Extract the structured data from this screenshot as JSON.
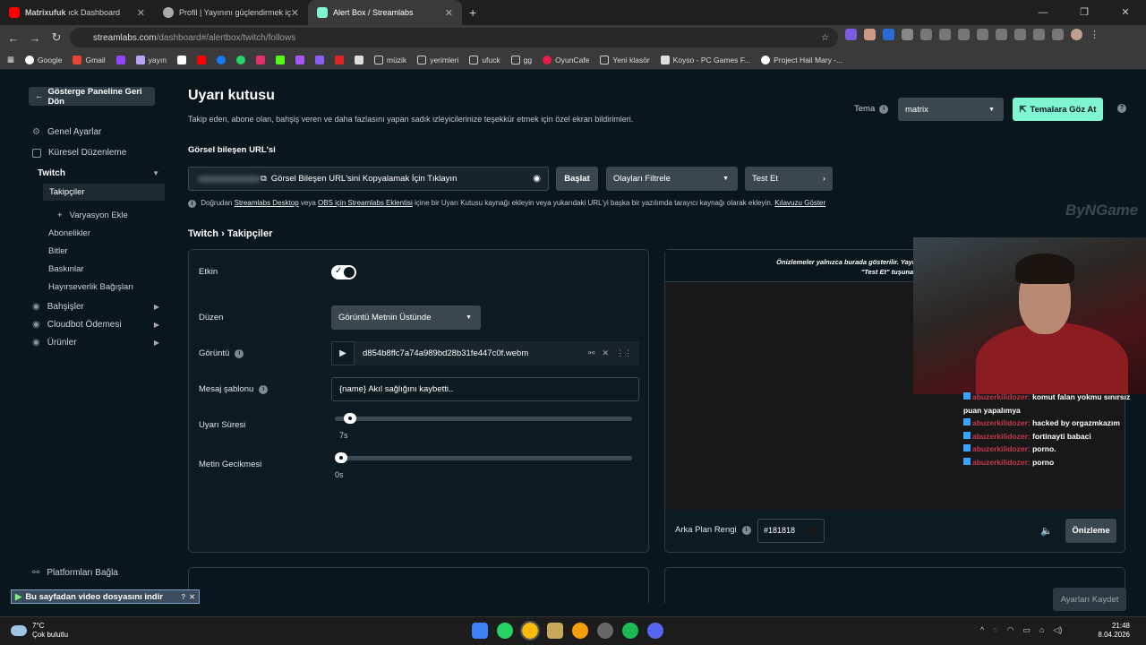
{
  "browser": {
    "tabs": [
      {
        "title": "Matrixufuk",
        "subtitle": "ıck Dashboard",
        "active": false
      },
      {
        "title": "Profil | Yayınını güçlendirmek iç",
        "active": false
      },
      {
        "title": "Alert Box / Streamlabs",
        "active": true
      }
    ],
    "url_domain": "streamlabs.com",
    "url_path": "/dashboard#/alertbox/twitch/follows",
    "bookmarks": [
      "Google",
      "Gmail",
      "yayın",
      "müzik",
      "yerimleri",
      "ufuck",
      "gg",
      "OyunCafe",
      "Yeni klasör",
      "Koyso - PC Games F...",
      "Project Hail Mary -..."
    ]
  },
  "sidebar": {
    "back_label": "Gösterge Paneline Geri Dön",
    "items": [
      {
        "label": "Genel Ayarlar"
      },
      {
        "label": "Küresel Düzenleme"
      },
      {
        "label": "Twitch"
      },
      {
        "label": "Takipçiler"
      },
      {
        "label": "Varyasyon Ekle"
      },
      {
        "label": "Abonelikler"
      },
      {
        "label": "Bitler"
      },
      {
        "label": "Baskınlar"
      },
      {
        "label": "Hayırseverlik Bağışları"
      },
      {
        "label": "Bahşişler"
      },
      {
        "label": "Cloudbot Ödemesi"
      },
      {
        "label": "Ürünler"
      },
      {
        "label": "Platformları Bağla"
      }
    ]
  },
  "page": {
    "title": "Uyarı kutusu",
    "description": "Takip eden, abone olan, bahşiş veren ve daha fazlasını yapan sadık izleyicilerinize teşekkür etmek için özel ekran bildirimleri.",
    "theme_label": "Tema",
    "theme_value": "matrix",
    "browse_themes": "Temalara Göz At",
    "widget_url_label": "Görsel bileşen URL'si",
    "copy_url_label": "Görsel Bileşen URL'sini Kopyalamak İçin Tıklayın",
    "start_button": "Başlat",
    "filter_events": "Olayları Filtrele",
    "test_button": "Test Et",
    "note_prefix": "Doğrudan",
    "note_link1": "Streamlabs Desktop",
    "note_mid1": "veya",
    "note_link2": "OBS için Streamlabs Eklentisi",
    "note_mid2": "içine bir Uyarı Kutusu kaynağı ekleyin veya yukarıdaki URL'yi başka bir yazılımda tarayıcı kaynağı olarak ekleyin.",
    "note_link3": "Kılavuzu Göster",
    "breadcrumb_1": "Twitch",
    "breadcrumb_sep": "›",
    "breadcrumb_2": "Takipçiler"
  },
  "settings": {
    "enabled_label": "Etkin",
    "enabled": true,
    "layout_label": "Düzen",
    "layout_value": "Görüntü Metnin Üstünde",
    "image_label": "Görüntü",
    "image_file": "d854b8ffc7a74a989bd28b31fe447c0f.webm",
    "message_label": "Mesaj şablonu",
    "message_value": "{name}  Akıl sağlığını kaybetti..",
    "duration_label": "Uyarı Süresi",
    "duration_value": "7s",
    "duration_fraction": 0.02,
    "delay_label": "Metin Gecikmesi",
    "delay_value": "0s",
    "delay_fraction": 0.0
  },
  "preview": {
    "notice_line1": "Önizlemeler yalnızca burada gösterilir. Yayın yazılımınızda etkinlikleri görü",
    "notice_line2": "\"Test Et\" tuşuna tıkla",
    "bg_label": "Arka Plan Rengi",
    "bg_value": "#181818",
    "preview_button": "Önizleme"
  },
  "overlay": {
    "watermark": "ByNGame",
    "chat": [
      {
        "user": "abuzerkilidozer:",
        "msg": "komut falan yokmu sınırsız puan yapalımya"
      },
      {
        "user": "abuzerkilidozer:",
        "msg": "hacked by orgazmkazım"
      },
      {
        "user": "abuzerkilidozer:",
        "msg": "fortinayti babaci"
      },
      {
        "user": "abuzerkilidozer:",
        "msg": "porno."
      },
      {
        "user": "abuzerkilidozer:",
        "msg": "porno"
      }
    ],
    "download_bar": "Bu sayfadan video dosyasını indir"
  },
  "footer": {
    "save_label": "Ayarları Kaydet"
  },
  "taskbar": {
    "temp": "7°C",
    "weather": "Çok bulutlu",
    "time": "21:48",
    "date": "8.04.2026"
  },
  "colors": {
    "accent": "#80f5d2",
    "panel": "#0c1a21",
    "background": "#09161d"
  }
}
